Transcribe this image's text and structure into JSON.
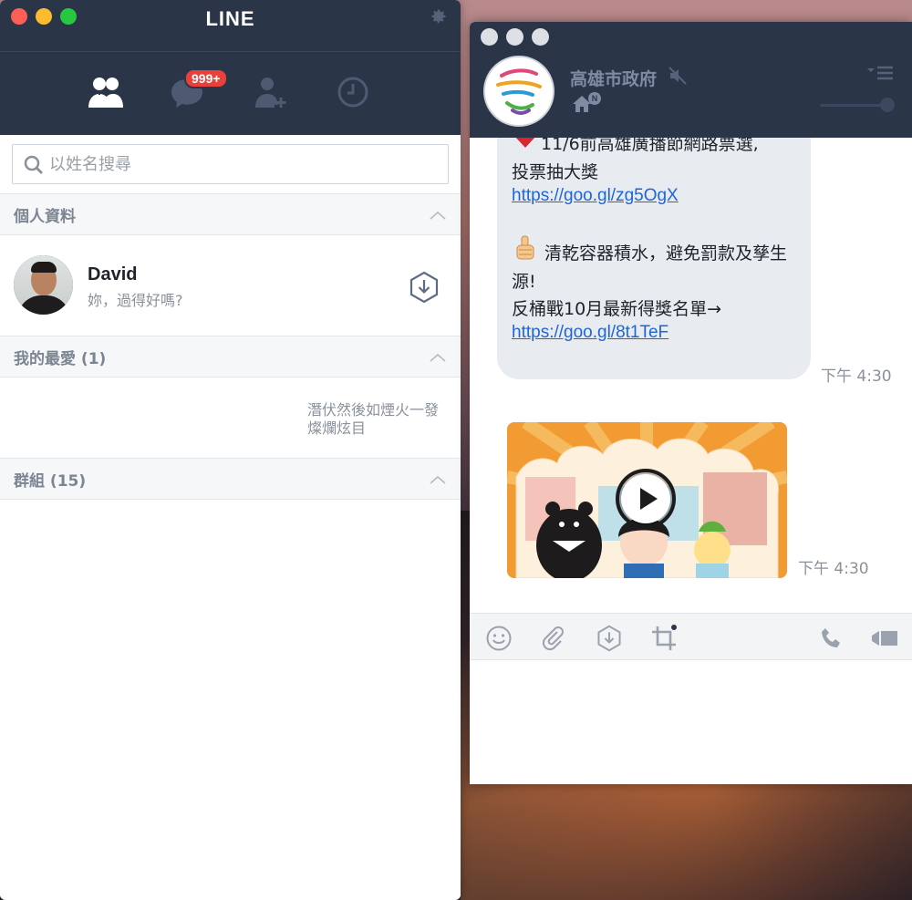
{
  "line_window": {
    "app_title": "LINE",
    "badge_count": "999+",
    "nav": [
      {
        "name": "friends",
        "icon": "friends-icon"
      },
      {
        "name": "chats",
        "icon": "chat-bubble-icon"
      },
      {
        "name": "add-friend",
        "icon": "add-friend-icon"
      },
      {
        "name": "timeline",
        "icon": "clock-icon"
      }
    ],
    "search": {
      "placeholder": "以姓名搜尋",
      "value": ""
    },
    "sections": {
      "profile": "個人資料",
      "favorites": "我的最愛 (1)",
      "groups": "群組 (15)"
    },
    "profile": {
      "name": "David",
      "status": "妳，過得好嗎?"
    },
    "favorite_item": {
      "status_text": "潛伏然後如煙火一發燦爛炫目"
    }
  },
  "chat_window": {
    "title": "高雄市政府",
    "badge_letter": "N",
    "messages": {
      "line1": "11/6前高雄廣播節網路票選,",
      "line2": "投票抽大獎",
      "link1": "https://goo.gl/zg5OgX",
      "line3": "清乾容器積水，避免罰款及孳生",
      "line4": "源!",
      "line5": "反桶戰10月最新得獎名單→",
      "link2": "https://goo.gl/8t1TeF",
      "time1": "下午 4:30",
      "time2": "下午 4:30"
    },
    "colors": {
      "titlebar": "#2b3548",
      "link": "#1e66d8",
      "bubble": "#e8ebef",
      "badge": "#e8413b"
    }
  }
}
